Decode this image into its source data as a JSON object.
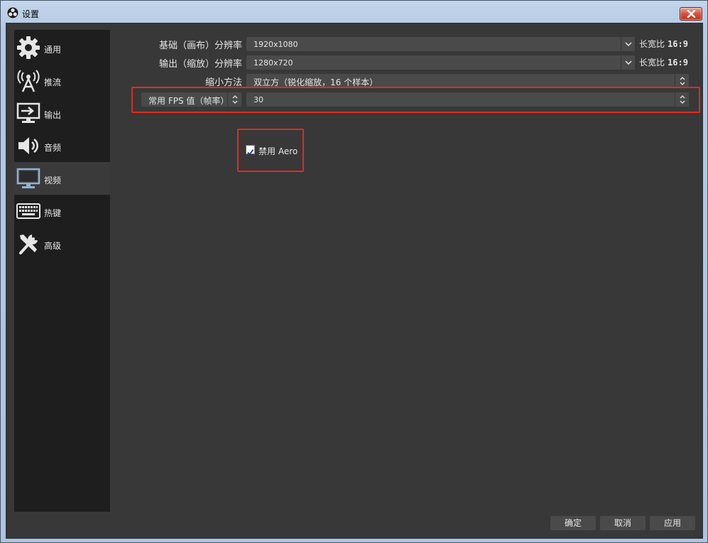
{
  "window": {
    "title": "设置"
  },
  "sidebar": {
    "items": [
      {
        "label": "通用",
        "icon": "gear-icon"
      },
      {
        "label": "推流",
        "icon": "antenna-icon"
      },
      {
        "label": "输出",
        "icon": "output-monitor-icon"
      },
      {
        "label": "音频",
        "icon": "speaker-icon"
      },
      {
        "label": "视频",
        "icon": "monitor-icon",
        "active": true
      },
      {
        "label": "热键",
        "icon": "keyboard-icon"
      },
      {
        "label": "高级",
        "icon": "tools-icon"
      }
    ]
  },
  "video": {
    "base_resolution": {
      "label": "基础（画布）分辨率",
      "value": "1920x1080",
      "aspect_label": "长宽比",
      "aspect_value": "16:9"
    },
    "output_resolution": {
      "label": "输出（缩放）分辨率",
      "value": "1280x720",
      "aspect_label": "长宽比",
      "aspect_value": "16:9"
    },
    "downscale_filter": {
      "label": "缩小方法",
      "value": "双立方（锐化缩放，16 个样本）"
    },
    "fps": {
      "type_value": "常用 FPS 值（帧率）",
      "value": "30"
    },
    "disable_aero": {
      "label": "禁用 Aero",
      "checked": true
    }
  },
  "buttons": {
    "ok": "确定",
    "cancel": "取消",
    "apply": "应用"
  },
  "colors": {
    "highlight": "#e02b20",
    "panel": "#383838",
    "sidebar": "#1e1e1e"
  }
}
